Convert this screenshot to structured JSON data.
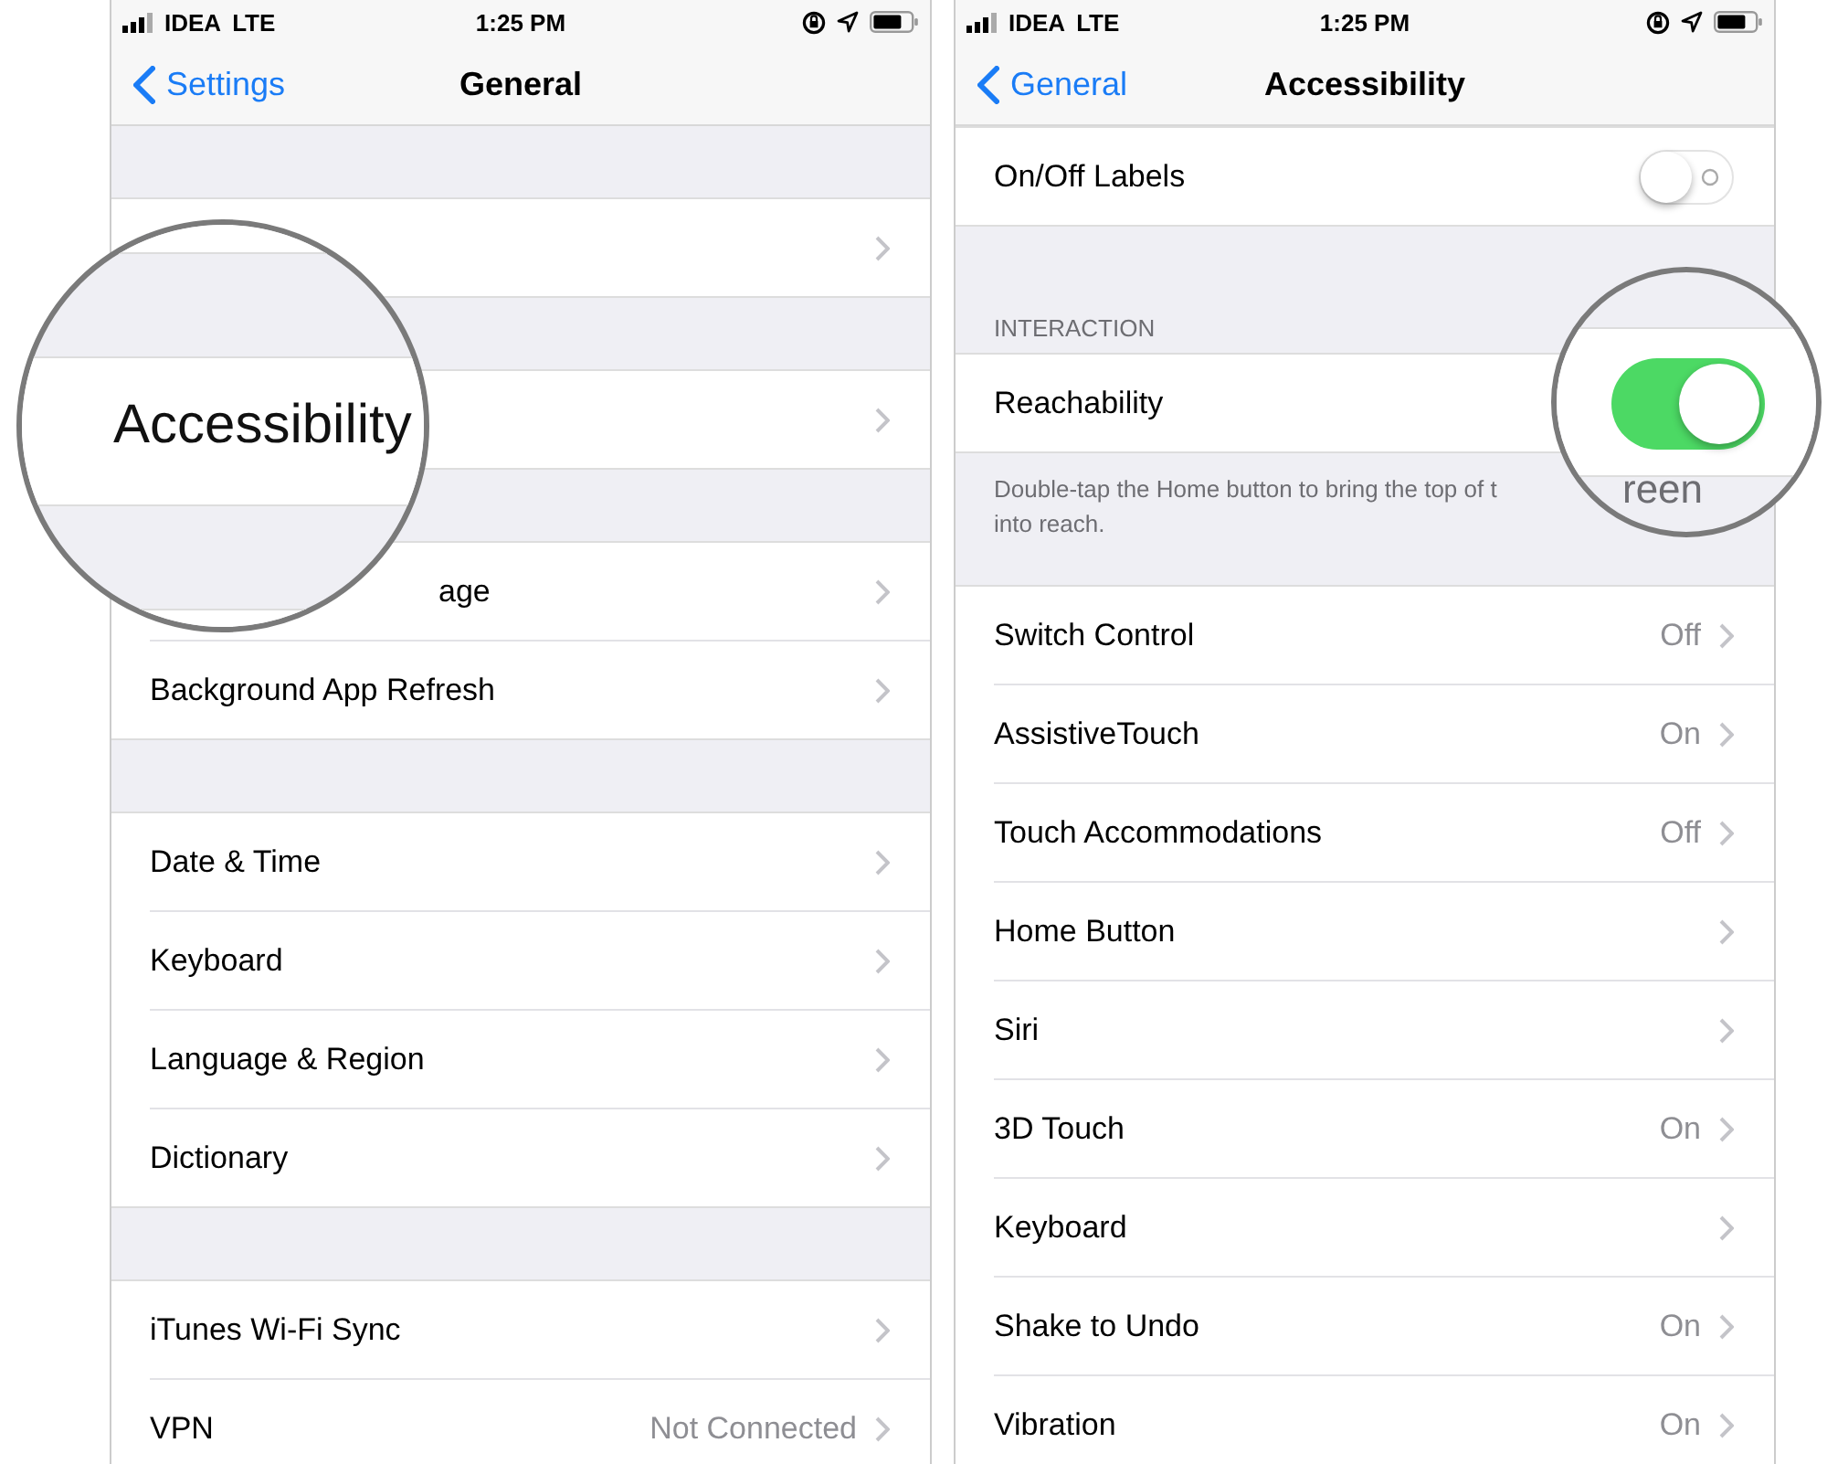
{
  "panels": [
    {
      "status_bar": {
        "carrier": "IDEA",
        "network": "LTE",
        "time": "1:25 PM"
      },
      "nav": {
        "back": "Settings",
        "title": "General"
      },
      "sections": [
        {
          "rows": [
            {
              "kind": "link"
            }
          ]
        },
        {
          "rows": [
            {
              "kind": "link"
            }
          ]
        },
        {
          "rows": [
            {
              "kind": "link",
              "label": "age",
              "covered": true
            },
            {
              "kind": "link",
              "label": "Background App Refresh"
            }
          ]
        },
        {
          "rows": [
            {
              "kind": "link",
              "label": "Date & Time"
            },
            {
              "kind": "link",
              "label": "Keyboard"
            },
            {
              "kind": "link",
              "label": "Language & Region"
            },
            {
              "kind": "link",
              "label": "Dictionary"
            }
          ]
        },
        {
          "rows": [
            {
              "kind": "link",
              "label": "iTunes Wi-Fi Sync"
            },
            {
              "kind": "link",
              "label": "VPN",
              "value": "Not Connected"
            }
          ]
        }
      ]
    },
    {
      "status_bar": {
        "carrier": "IDEA",
        "network": "LTE",
        "time": "1:25 PM"
      },
      "nav": {
        "back": "General",
        "title": "Accessibility"
      },
      "sections": [
        {
          "rows": [
            {
              "kind": "toggle",
              "label": "On/Off Labels",
              "on": false
            }
          ]
        },
        {
          "header": "INTERACTION",
          "rows": [
            {
              "kind": "label",
              "label": "Reachability"
            }
          ],
          "footer": [
            "Double-tap the Home button to bring the top of t",
            "into reach."
          ]
        },
        {
          "rows": [
            {
              "kind": "link",
              "label": "Switch Control",
              "value": "Off"
            },
            {
              "kind": "link",
              "label": "AssistiveTouch",
              "value": "On"
            },
            {
              "kind": "link",
              "label": "Touch Accommodations",
              "value": "Off"
            },
            {
              "kind": "link",
              "label": "Home Button"
            },
            {
              "kind": "link",
              "label": "Siri"
            },
            {
              "kind": "link",
              "label": "3D Touch",
              "value": "On"
            },
            {
              "kind": "link",
              "label": "Keyboard"
            },
            {
              "kind": "link",
              "label": "Shake to Undo",
              "value": "On"
            },
            {
              "kind": "link",
              "label": "Vibration",
              "value": "On"
            }
          ]
        }
      ]
    }
  ],
  "magnifiers": [
    {
      "kind": "text",
      "text": "Accessibility"
    },
    {
      "kind": "toggle",
      "on": true,
      "text": "reen"
    }
  ]
}
